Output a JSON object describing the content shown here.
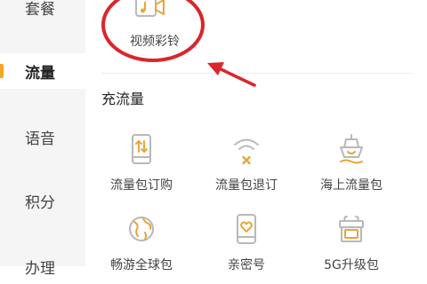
{
  "sidebar": {
    "items": [
      {
        "label": "套餐",
        "active": false
      },
      {
        "label": "流量",
        "active": true
      },
      {
        "label": "语音",
        "active": false
      },
      {
        "label": "积分",
        "active": false
      },
      {
        "label": "办理",
        "active": false
      }
    ]
  },
  "main": {
    "top_item": {
      "label": "视频彩铃",
      "icon": "video-ringtone-icon"
    },
    "section": {
      "title": "充流量",
      "items": [
        {
          "label": "流量包订购",
          "icon": "phone-data-icon"
        },
        {
          "label": "流量包退订",
          "icon": "wifi-cancel-icon"
        },
        {
          "label": "海上流量包",
          "icon": "ship-icon"
        },
        {
          "label": "畅游全球包",
          "icon": "globe-icon"
        },
        {
          "label": "亲密号",
          "icon": "phone-heart-icon"
        },
        {
          "label": "5G升级包",
          "icon": "gift-5g-icon"
        }
      ]
    }
  },
  "colors": {
    "accent": "#f5a623",
    "icon_gray": "#b8b8b8",
    "icon_orange": "#e9a53a",
    "annotation_red": "#d9262c",
    "sidebar_bg": "#f5f5f5"
  }
}
